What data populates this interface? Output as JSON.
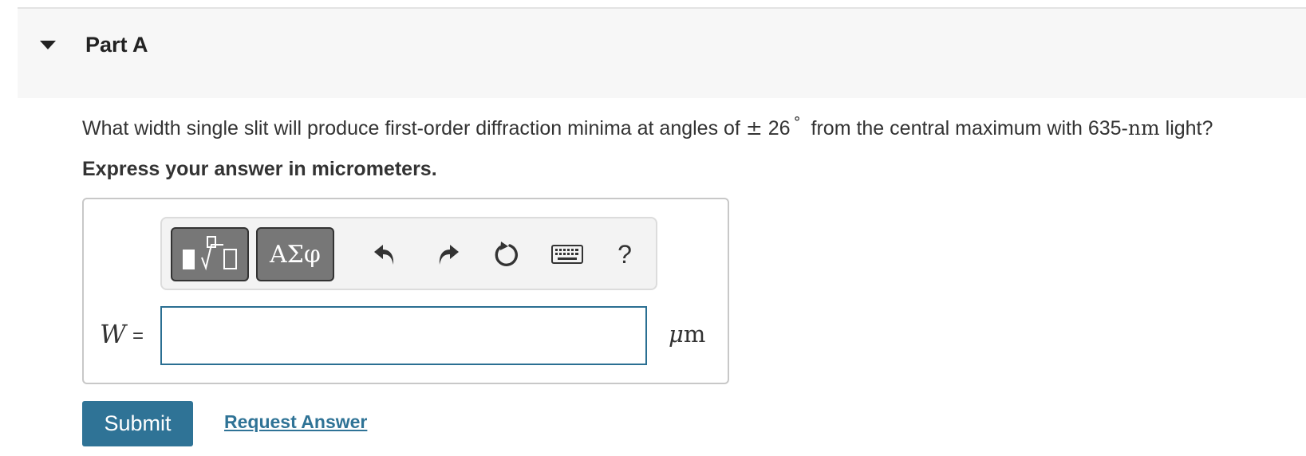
{
  "part": {
    "title": "Part A"
  },
  "question": {
    "text_before": "What width single slit will produce first-order diffraction minima at angles of",
    "plus_minus": "±",
    "angle_value": "26",
    "degree_symbol": "°",
    "text_middle": "from the central maximum with 635-",
    "wavelength_unit": "nm",
    "text_after": "light?"
  },
  "instruction": "Express your answer in micrometers.",
  "toolbar": {
    "greek_label": "ΑΣφ",
    "help_label": "?",
    "icons": [
      "templates-icon",
      "undo-icon",
      "redo-icon",
      "reset-icon",
      "keyboard-icon"
    ]
  },
  "answer": {
    "variable": "W",
    "equals": "=",
    "value": "",
    "unit_prefix": "μ",
    "unit_base": "m"
  },
  "actions": {
    "submit_label": "Submit",
    "request_label": "Request Answer"
  },
  "colors": {
    "accent": "#2f7396",
    "input_border": "#2a6f92",
    "toolbar_button": "#777777",
    "header_bg": "#f7f7f7"
  }
}
